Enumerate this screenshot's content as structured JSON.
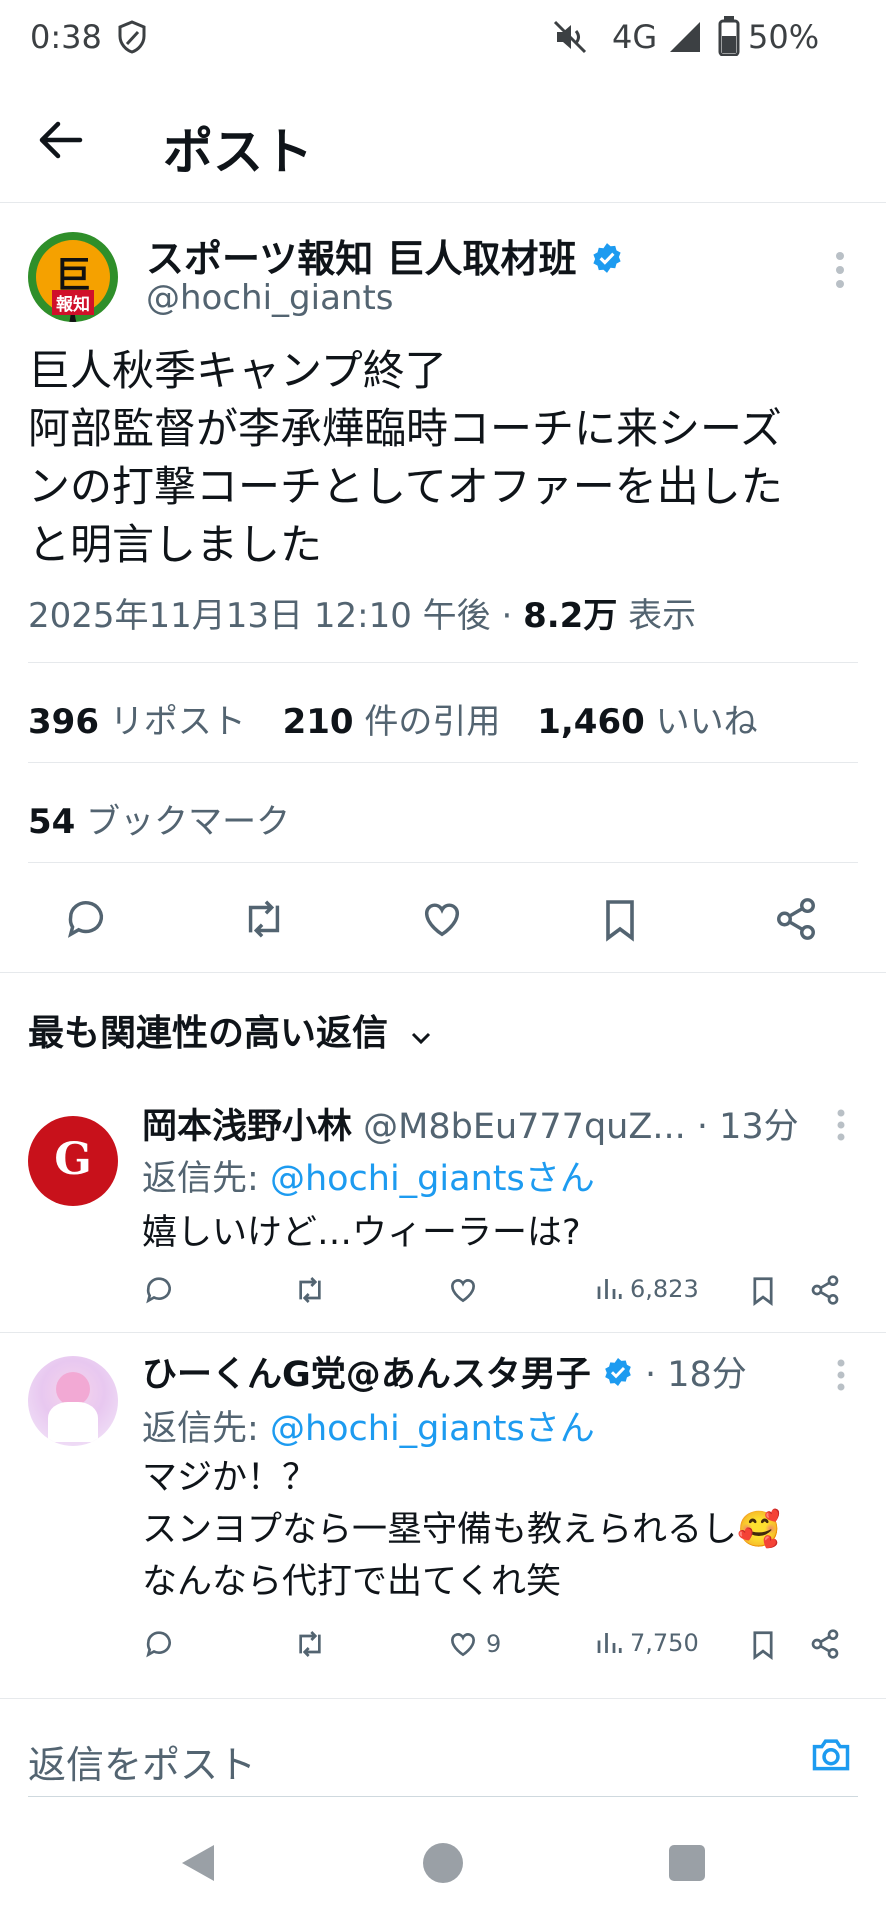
{
  "status": {
    "time": "0:38",
    "network": "4G",
    "battery": "50%"
  },
  "header": {
    "title": "ポスト"
  },
  "post": {
    "author_name": "スポーツ報知 巨人取材班",
    "handle": "@hochi_giants",
    "avatar_text_top": "巨人",
    "avatar_text_bottom": "報知",
    "text_line1": "巨人秋季キャンプ終了",
    "text_line2": "阿部監督が李承燁臨時コーチに来シーズ",
    "text_line3": "ンの打撃コーチとしてオファーを出した",
    "text_line4": "と明言しました",
    "timestamp": "2025年11月13日 12:10 午後 ·",
    "views_count": "8.2万",
    "views_label": "表示",
    "reposts_count": "396",
    "reposts_label": "リポスト",
    "quotes_count": "210",
    "quotes_label": "件の引用",
    "likes_count": "1,460",
    "likes_label": "いいね",
    "bookmarks_count": "54",
    "bookmarks_label": "ブックマーク"
  },
  "replies_section": {
    "sort_label": "最も関連性の高い返信"
  },
  "replies": [
    {
      "author_name": "岡本浅野小林",
      "handle": "@M8bEu777quZ...",
      "time": "· 13分",
      "reply_to_label": "返信先:",
      "reply_to_handle": "@hochi_giantsさん",
      "text_line1": "嬉しいけど…ウィーラーは?",
      "likes": "",
      "views": "6,823"
    },
    {
      "author_name": "ひーくんG党@あんスタ男子",
      "handle": "",
      "time": "· 18分",
      "reply_to_label": "返信先:",
      "reply_to_handle": "@hochi_giantsさん",
      "text_line1": "マジか！？",
      "text_line2": "スンヨプなら一塁守備も教えられるし🥰",
      "text_line3": "なんなら代打で出てくれ笑",
      "likes": "9",
      "views": "7,750"
    }
  ],
  "composer": {
    "placeholder": "返信をポスト"
  },
  "colors": {
    "accent": "#1d9bf0",
    "text": "#0f1419",
    "secondary": "#536471"
  }
}
